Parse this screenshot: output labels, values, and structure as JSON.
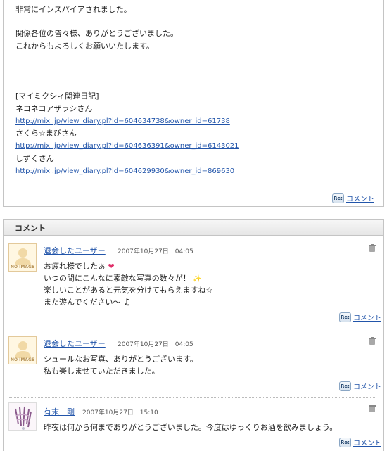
{
  "diary": {
    "lines": [
      "非常にインスパイアされました。",
      "関係各位の皆々様、ありがとうございました。",
      "これからもよろしくお願いいたします。",
      "[マイミクシィ関連日記]",
      "ネコネコアザラシさん",
      "さくら☆まびさん",
      "しずくさん"
    ],
    "links": [
      "http://mixi.jp/view_diary.pl?id=604634738&owner_id=61738",
      "http://mixi.jp/view_diary.pl?id=604636391&owner_id=6143021",
      "http://mixi.jp/view_diary.pl?id=604629930&owner_id=869630"
    ],
    "reply_badge": "Re:",
    "reply_label": "コメント"
  },
  "comments": {
    "header": "コメント",
    "noimage": "NO IMAGE",
    "items": [
      {
        "name": "退会したユーザー",
        "date": "2007年10月27日　04:05",
        "lines": [
          "お疲れ様でしたぁ",
          "いつの間にこんなに素敵な写真の数々が！",
          "楽しいことがあると元気を分けてもらえますね☆",
          "また遊んでください～"
        ],
        "reply_badge": "Re:",
        "reply_label": "コメント"
      },
      {
        "name": "退会したユーザー",
        "date": "2007年10月27日　04:05",
        "lines": [
          "シュールなお写真、ありがとうございます。",
          "私も楽しませていただきました。"
        ],
        "reply_badge": "Re:",
        "reply_label": "コメント"
      },
      {
        "name": "有末　剛",
        "date": "2007年10月27日　15:10",
        "lines": [
          "昨夜は何から何までありがとうございました。今度はゆっくりお酒を飲みましょう。"
        ],
        "reply_badge": "Re:",
        "reply_label": "コメント"
      }
    ]
  }
}
